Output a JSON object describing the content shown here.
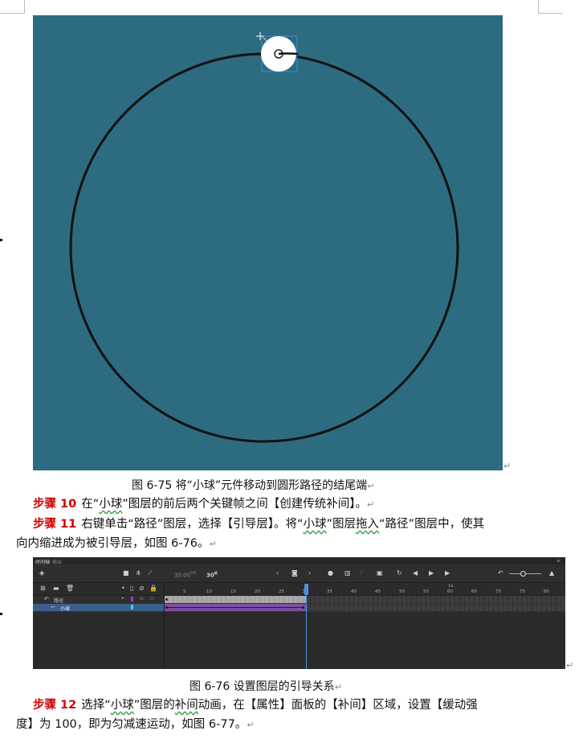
{
  "figure1": {
    "caption": "图 6-75 将“小球”元件移动到圆形路径的结尾端",
    "colors": {
      "stage": "#2d6b80",
      "path": "#111111",
      "ball": "#ffffff",
      "selection": "#3b8fd6"
    }
  },
  "step10": {
    "label": "步骤 10",
    "t1": "在“",
    "t2": "小球",
    "t3": "”图层的前后两个关键帧之间【创建传统补间】。"
  },
  "step11": {
    "label": "步骤 11",
    "t1": "右键单击“路径”图层，选择【引导层】。将“",
    "t2": "小球",
    "t3": "”图层",
    "t4": "拖入",
    "t5": "“路径”图层中，使其",
    "line2": "向内缩进成为被引导层，如图 6-76。"
  },
  "figure2": {
    "caption": "图 6-76 设置图层的引导关系",
    "tabs": [
      "时间轴",
      "输出"
    ],
    "fps": "30.00",
    "fps_unit": "FPS",
    "frame": "30",
    "frame_unit": "帧",
    "ruler_second": "1s",
    "ruler_ticks": [
      "5",
      "10",
      "15",
      "20",
      "25",
      "30",
      "35",
      "40",
      "45",
      "50",
      "55",
      "60",
      "65",
      "70",
      "75",
      "80"
    ],
    "layers": [
      {
        "name": "路径",
        "icon": "guide-layer-icon"
      },
      {
        "name": "小球",
        "icon": "guided-layer-icon"
      }
    ],
    "colors": {
      "panel": "#323232",
      "playhead": "#4a90e2",
      "tween": "#7f4fa0",
      "selected_row": "#3b5f8a"
    }
  },
  "step12": {
    "label": "步骤 12",
    "t1": "选择“",
    "t2": "小球",
    "t3": "”图层的",
    "t4": "补间",
    "t5": "动画，在【属性】面板的【补间】区域，设置【缓动强",
    "line2": "度】为 100，即为匀减速运动，如图 6-77。"
  },
  "marks": {
    "para_end": "↵"
  }
}
